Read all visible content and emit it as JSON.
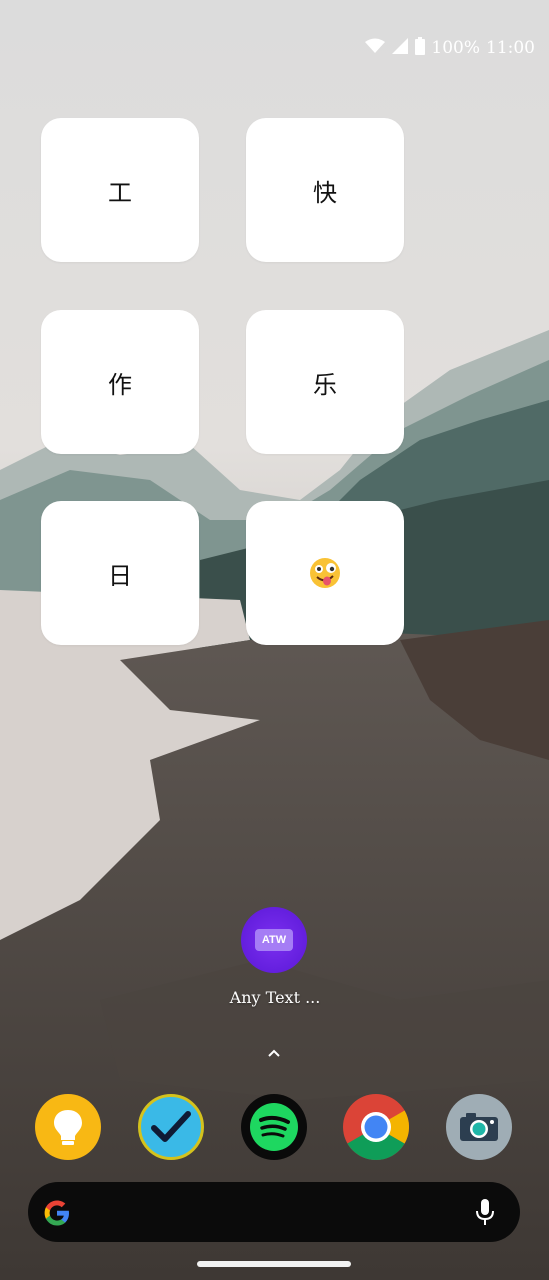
{
  "status": {
    "battery": "100%",
    "time": "11:00",
    "icons": [
      "wifi-icon",
      "signal-icon",
      "battery-icon"
    ]
  },
  "widgets": [
    {
      "char": "工"
    },
    {
      "char": "快"
    },
    {
      "char": "作"
    },
    {
      "char": "乐"
    },
    {
      "char": "日"
    },
    {
      "char": "🤪"
    }
  ],
  "app": {
    "icon_text": "ATW",
    "label": "Any Text ..."
  },
  "dock": [
    "keep-notes-icon",
    "tasks-checkmark-icon",
    "spotify-icon",
    "chrome-icon",
    "camera-icon"
  ],
  "colors": {
    "keep": "#f8b814",
    "tasks": "#3ab9e7",
    "spotify": "#1ed760",
    "chrome_red": "#db4437",
    "chrome_yellow": "#f4b400",
    "chrome_green": "#0f9d58",
    "chrome_blue": "#4285f4",
    "camera": "#9fadb5",
    "atw": "#6a21e0"
  }
}
